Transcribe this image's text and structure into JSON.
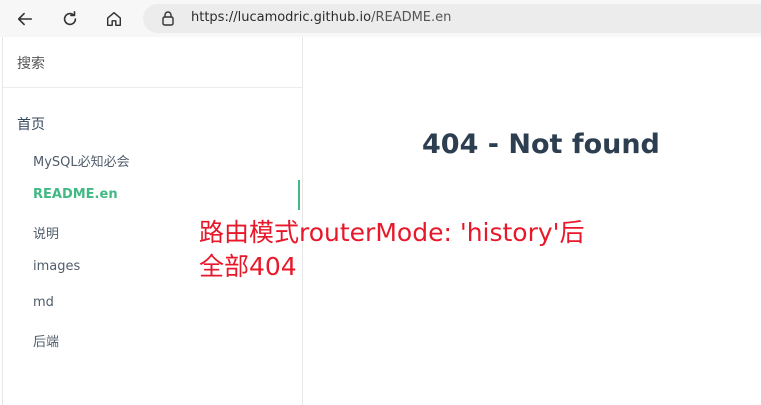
{
  "browser": {
    "url_host": "https://lucamodric.github.io",
    "url_path": "/README.en"
  },
  "sidebar": {
    "search_placeholder": "搜索",
    "home_label": "首页",
    "items": [
      {
        "label": "MySQL必知必会",
        "active": false
      },
      {
        "label": "README.en",
        "active": true
      },
      {
        "label": "说明",
        "active": false
      },
      {
        "label": "images",
        "active": false
      },
      {
        "label": "md",
        "active": false
      },
      {
        "label": "后端",
        "active": false
      }
    ]
  },
  "main": {
    "heading": "404 - Not found"
  },
  "annotation": {
    "line1": "路由模式routerMode: 'history'后",
    "line2": "全部404"
  },
  "colors": {
    "accent": "#42b983",
    "annotation": "#e8182a",
    "heading": "#2c3e50"
  },
  "icons": [
    "back-arrow-icon",
    "reload-icon",
    "home-icon",
    "lock-icon"
  ]
}
